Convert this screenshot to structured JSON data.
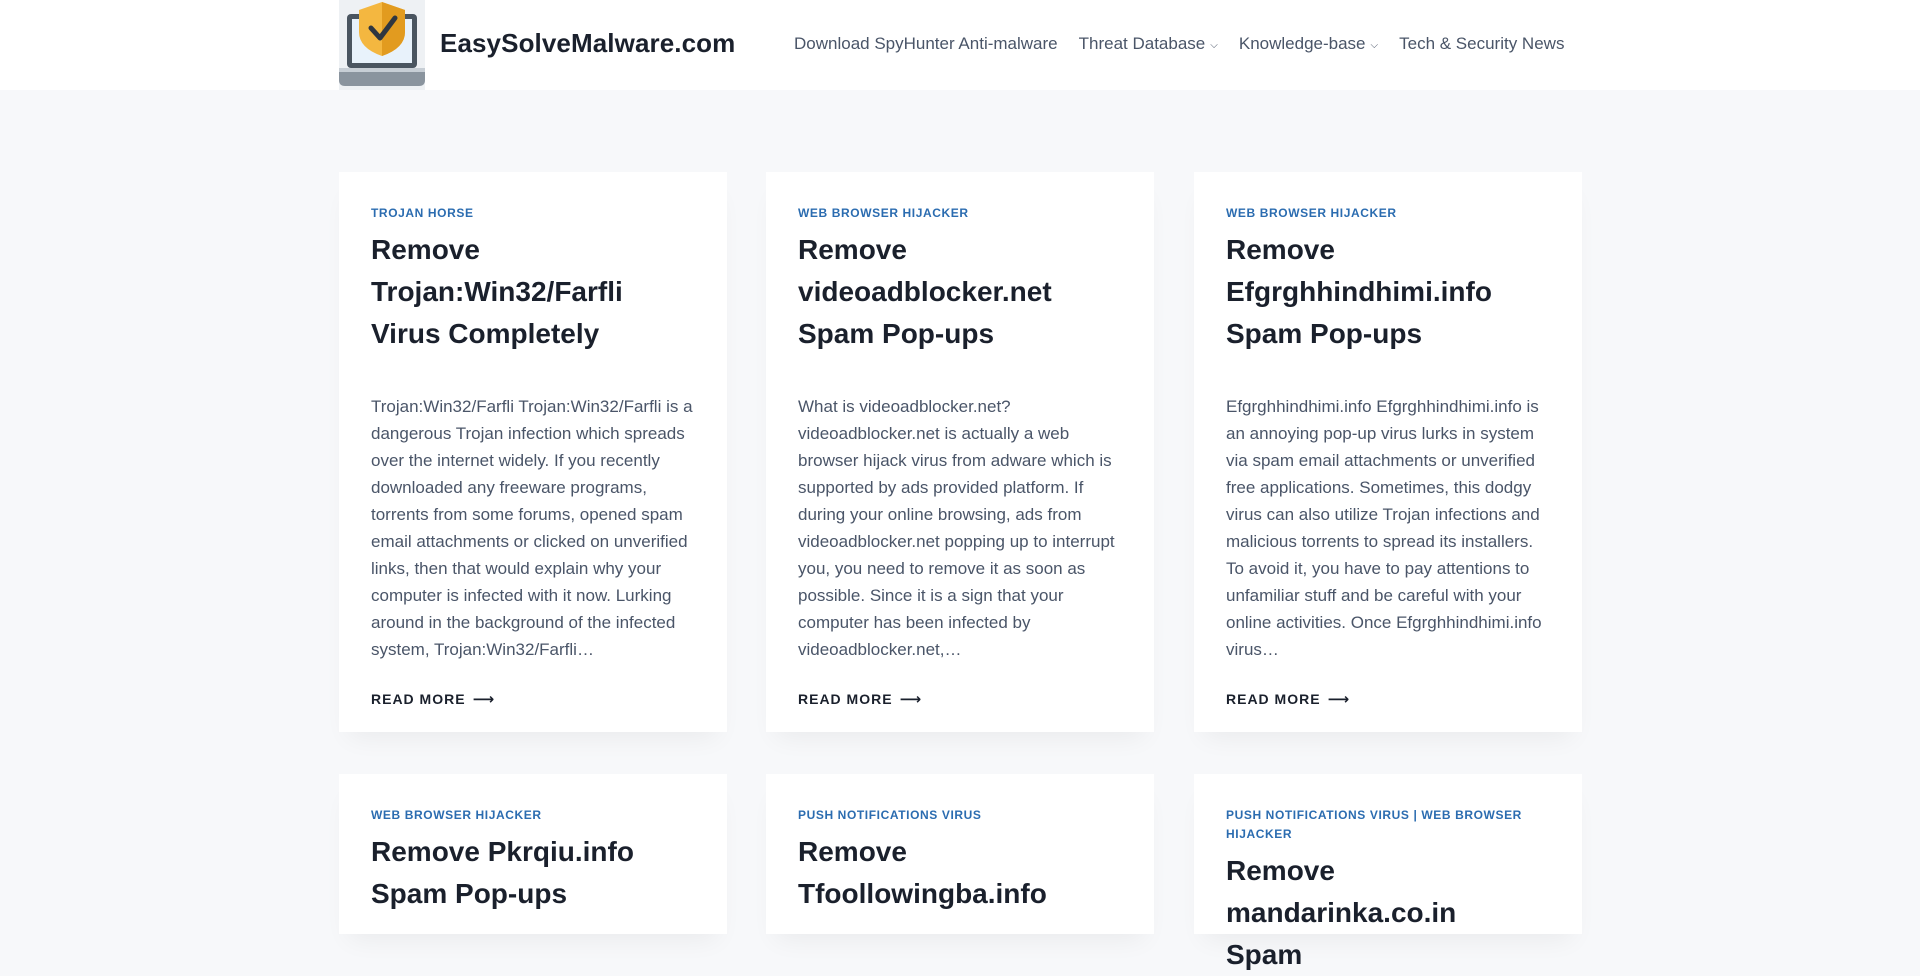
{
  "header": {
    "site_title": "EasySolveMalware.com",
    "logo_icon": "shield-check-laptop-icon",
    "nav": [
      {
        "label": "Download SpyHunter Anti-malware",
        "dropdown": false
      },
      {
        "label": "Threat Database",
        "dropdown": true
      },
      {
        "label": "Knowledge-base",
        "dropdown": true
      },
      {
        "label": "Tech & Security News",
        "dropdown": false
      }
    ],
    "chevron": "⌵"
  },
  "cards": [
    {
      "category": "TROJAN HORSE",
      "title_lines": [
        "Remove",
        "Trojan:Win32/Farfli",
        "Virus Completely"
      ],
      "excerpt": "Trojan:Win32/Farfli Trojan:Win32/Farfli is a dangerous Trojan infection which spreads over the internet widely. If you recently downloaded any freeware programs, torrents from some forums, opened spam email attachments or clicked on unverified links, then that would explain why your computer is infected with it now. Lurking around in the background of the infected system, Trojan:Win32/Farfli…",
      "read_more": "READ MORE"
    },
    {
      "category": "WEB BROWSER HIJACKER",
      "title_lines": [
        "Remove",
        "videoadblocker.net",
        "Spam Pop-ups"
      ],
      "excerpt": "What is videoadblocker.net? videoadblocker.net is actually a web browser hijack virus from adware which is supported by ads provided platform. If during your online browsing, ads from videoadblocker.net popping up to interrupt you, you need to remove it as soon as possible. Since it is a sign that your computer has been infected by videoadblocker.net,…",
      "read_more": "READ MORE"
    },
    {
      "category": "WEB BROWSER HIJACKER",
      "title_lines": [
        "Remove",
        "Efgrghhindhimi.info",
        "Spam Pop-ups"
      ],
      "excerpt": "Efgrghhindhimi.info Efgrghhindhimi.info is an annoying pop-up virus lurks in system via spam email attachments or unverified free applications. Sometimes, this dodgy virus can also utilize Trojan infections and malicious torrents to spread its installers. To avoid it, you have to pay attentions to unfamiliar stuff and be careful with your online activities. Once Efgrghhindhimi.info virus…",
      "read_more": "READ MORE"
    },
    {
      "category": "WEB BROWSER HIJACKER",
      "title_lines": [
        "Remove Pkrqiu.info",
        "Spam Pop-ups"
      ]
    },
    {
      "category": "PUSH NOTIFICATIONS VIRUS",
      "title_lines": [
        "Remove",
        "Tfoollowingba.info"
      ]
    },
    {
      "category": "PUSH NOTIFICATIONS VIRUS | WEB BROWSER HIJACKER",
      "title_lines": [
        "Remove",
        "mandarinka.co.in Spam"
      ]
    }
  ],
  "arrow_glyph": "⟶"
}
